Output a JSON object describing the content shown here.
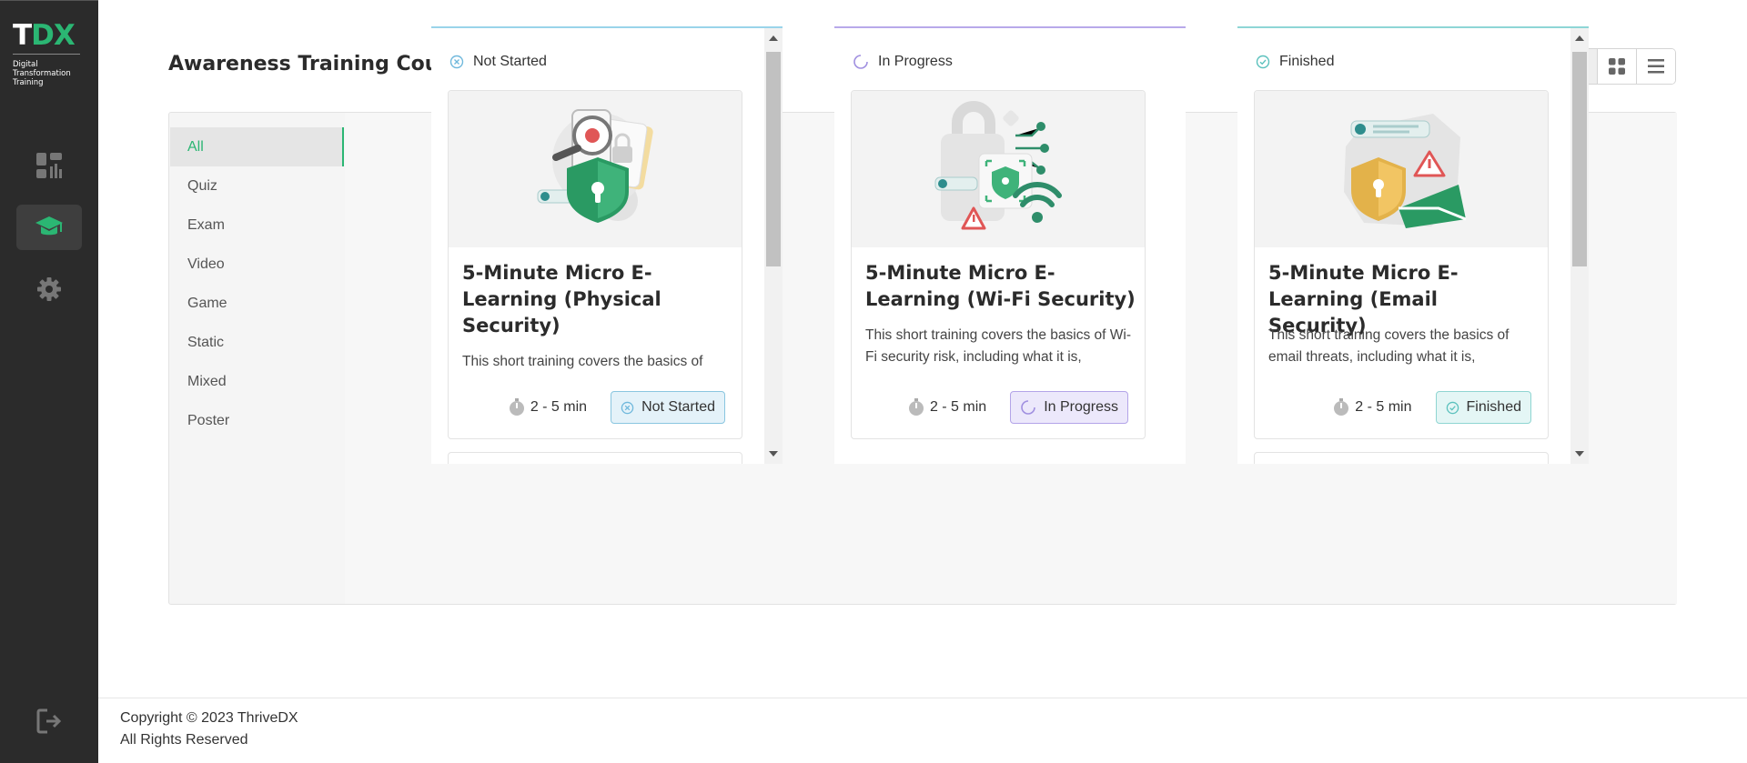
{
  "app": {
    "logo_mark_t": "T",
    "logo_mark_dx": "DX",
    "logo_sub": [
      "Digital",
      "Transformation",
      "Training"
    ]
  },
  "colors": {
    "brand_green": "#2bb673",
    "sidebar_bg": "#2b2b2b",
    "not_started": "#8ac6e0",
    "in_progress": "#b3a4e8",
    "finished": "#8fd5d2"
  },
  "sidebar": {
    "items": [
      {
        "icon": "dashboard-icon",
        "active": false
      },
      {
        "icon": "graduation-cap-icon",
        "active": true
      },
      {
        "icon": "gear-icon",
        "active": false
      }
    ],
    "logout_icon": "logout-icon"
  },
  "header": {
    "title": "Awareness Training Courses",
    "view_modes": [
      "board-view-icon",
      "grid-view-icon",
      "list-view-icon"
    ],
    "active_view": "board-view-icon"
  },
  "filters": [
    "All",
    "Quiz",
    "Exam",
    "Video",
    "Game",
    "Static",
    "Mixed",
    "Poster"
  ],
  "active_filter": "All",
  "columns": [
    {
      "status": "Not Started",
      "card": {
        "title": "5-Minute Micro E-Learning (Physical Security)",
        "description": "This short training covers the basics of",
        "duration": "2 - 5 min",
        "status_label": "Not Started"
      }
    },
    {
      "status": "In Progress",
      "card": {
        "title": "5-Minute Micro E-Learning (Wi-Fi Security)",
        "description": "This short training covers the basics of Wi-Fi security risk, including what it is,",
        "duration": "2 - 5 min",
        "status_label": "In Progress"
      }
    },
    {
      "status": "Finished",
      "card": {
        "title": "5-Minute Micro E-Learning (Email Security)",
        "description": "This short training covers the basics of email threats, including what it is,",
        "duration": "2 - 5 min",
        "status_label": "Finished"
      }
    }
  ],
  "footer": {
    "copyright": "Copyright © 2023 ThriveDX",
    "rights": "All Rights Reserved"
  }
}
